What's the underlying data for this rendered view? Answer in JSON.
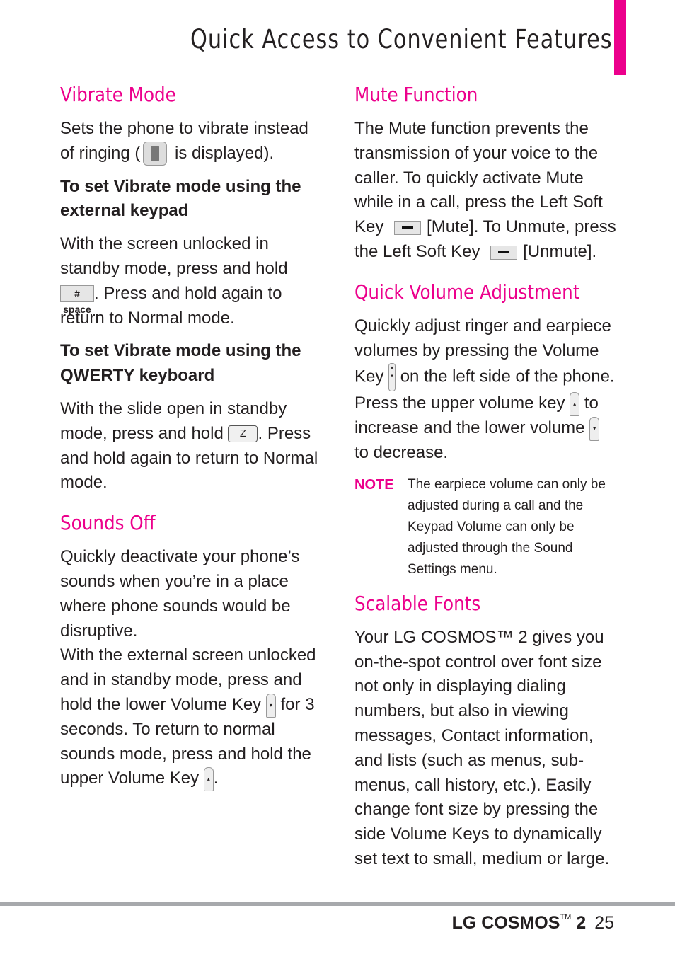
{
  "page": {
    "title": "Quick Access to Convenient Features",
    "accent_color": "#ec008c"
  },
  "left": {
    "vibrate": {
      "heading": "Vibrate Mode",
      "intro_a": "Sets the phone to vibrate instead of ringing (",
      "intro_b": " is displayed).",
      "sub1": "To set Vibrate mode using the external keypad",
      "p1_a": "With the screen unlocked in standby mode, press and hold ",
      "p1_key": "# space",
      "p1_b": ". Press and hold again to return to Normal mode.",
      "sub2": "To set Vibrate mode using the QWERTY keyboard",
      "p2_a": "With the slide open in standby mode, press and hold ",
      "p2_key": "Z",
      "p2_b": ". Press and hold again to return to Normal mode."
    },
    "sounds_off": {
      "heading": "Sounds Off",
      "p1": "Quickly deactivate your phone’s sounds when you’re in a place where phone sounds would be disruptive.",
      "p2_a": "With the external screen unlocked and in standby mode, press and hold the lower Volume Key ",
      "p2_key": "▾",
      "p2_b": " for 3 seconds. To return to normal sounds mode, press and hold the upper Volume Key ",
      "p2_key2": "▴",
      "p2_c": "."
    }
  },
  "right": {
    "mute": {
      "heading": "Mute Function",
      "p_a": "The Mute function prevents the transmission of your voice to the caller. To quickly activate Mute while in a call, press the Left Soft Key ",
      "mute_label": "[Mute]",
      "p_b": ". To Unmute, press the Left Soft Key ",
      "unmute_label": "[Unmute]",
      "p_c": "."
    },
    "volume": {
      "heading": "Quick Volume Adjustment",
      "p_a": "Quickly adjust ringer and earpiece volumes by pressing the Volume Key ",
      "p_b": " on the left side of the phone. Press the upper volume key ",
      "up_key": "▴",
      "p_c": " to increase and the lower volume ",
      "down_key": "▾",
      "p_d": " to decrease.",
      "note_label": "NOTE",
      "note_text": "The earpiece volume can only be adjusted during a call and the Keypad Volume can only be adjusted through the Sound Settings menu."
    },
    "fonts": {
      "heading": "Scalable Fonts",
      "p": "Your LG COSMOS™ 2 gives you on-the-spot control over font size not only in displaying dialing numbers, but also in viewing messages, Contact information, and lists (such as menus, sub-menus, call history, etc.). Easily change font size by pressing the side Volume Keys to dynamically set text to small, medium or large."
    }
  },
  "footer": {
    "brand": "LG COSMOS",
    "tm": "TM",
    "model": " 2",
    "page_number": "25"
  }
}
